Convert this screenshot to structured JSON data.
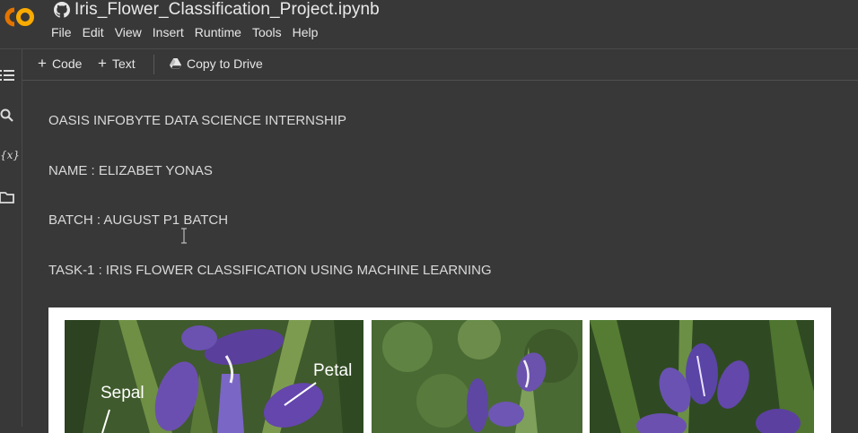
{
  "app": {
    "title": "Iris_Flower_Classification_Project.ipynb",
    "logo_text": "CO",
    "colors": {
      "logo_orange": "#f9ab00",
      "logo_orange_dark": "#e37400",
      "bg": "#383838"
    }
  },
  "menu": {
    "items": [
      "File",
      "Edit",
      "View",
      "Insert",
      "Runtime",
      "Tools",
      "Help"
    ]
  },
  "toolbar": {
    "code_label": "Code",
    "text_label": "Text",
    "copy_label": "Copy to Drive"
  },
  "sidebar": {
    "icons": [
      "toc-icon",
      "search-icon",
      "variables-icon",
      "folder-icon"
    ],
    "variables_glyph": "{x}"
  },
  "cell": {
    "lines": [
      "OASIS INFOBYTE DATA SCIENCE INTERNSHIP",
      "NAME : ELIZABET YONAS",
      "BATCH : AUGUST P1 BATCH",
      "TASK-1 : IRIS FLOWER CLASSIFICATION USING MACHINE LEARNING"
    ]
  },
  "image": {
    "labels": {
      "petal": "Petal",
      "sepal": "Sepal"
    }
  }
}
